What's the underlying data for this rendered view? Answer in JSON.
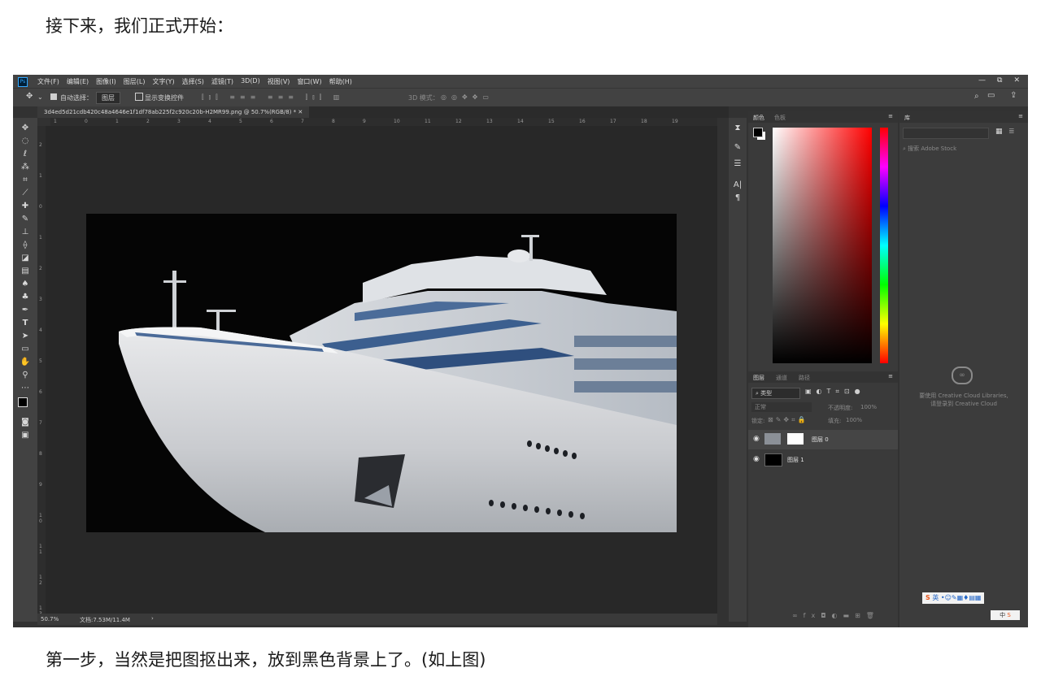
{
  "heading": "接下来，我们正式开始：",
  "footer_text": "第一步，当然是把图抠出来，放到黑色背景上了。(如上图)",
  "photoshop": {
    "menu": [
      "文件(F)",
      "编辑(E)",
      "图像(I)",
      "图层(L)",
      "文字(Y)",
      "选择(S)",
      "滤镜(T)",
      "3D(D)",
      "视图(V)",
      "窗口(W)",
      "帮助(H)"
    ],
    "logo": "Ps",
    "window_controls": [
      "—",
      "⧉",
      "✕"
    ],
    "options": {
      "auto_select": "自动选择：",
      "auto_select_value": "图层",
      "show_transform": "显示变换控件",
      "mode_3d": "3D 模式："
    },
    "doc_tab": "3d4ed5d21cdb420c48a4646e1f1df78ab225f2c920c20b-H2MR99.png @ 50.7%(RGB/8) *  ✕",
    "ruler_h": [
      "1",
      "0",
      "1",
      "2",
      "3",
      "4",
      "5",
      "6",
      "7",
      "8",
      "9",
      "10",
      "11",
      "12",
      "13",
      "14",
      "15",
      "16",
      "17",
      "18",
      "19"
    ],
    "ruler_v": [
      "2",
      "1",
      "0",
      "1",
      "2",
      "3",
      "4",
      "5",
      "6",
      "7",
      "8",
      "9",
      "1 0",
      "1 1",
      "1 2",
      "1 3"
    ],
    "status": {
      "zoom": "50.7%",
      "doc": "文档:7.53M/11.4M",
      "arrow": "›"
    },
    "color_panel": {
      "tab_color": "颜色",
      "tab_swatches": "色板"
    },
    "layers_panel": {
      "tabs": [
        "图层",
        "通道",
        "路径"
      ],
      "filter": "类型",
      "blend": "正常",
      "opacity_label": "不透明度:",
      "opacity": "100%",
      "lock_label": "锁定:",
      "fill_label": "填充:",
      "fill": "100%",
      "layers": [
        {
          "name": "图层 0"
        },
        {
          "name": "图层 1"
        }
      ]
    },
    "library_panel": {
      "tab": "库",
      "search": "搜索 Adobe Stock",
      "msg1": "要使用 Creative Cloud Libraries,",
      "msg2": "请登录到 Creative Cloud"
    },
    "ime": {
      "label": "英",
      "side": "中"
    }
  }
}
